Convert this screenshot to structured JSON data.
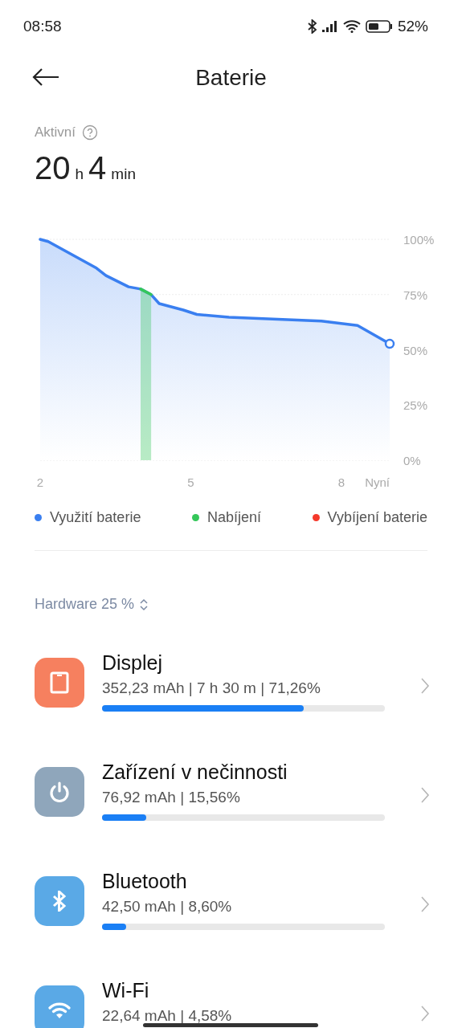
{
  "status_bar": {
    "time": "08:58",
    "battery": "52%"
  },
  "header": {
    "title": "Baterie"
  },
  "active": {
    "label": "Aktivní",
    "hours": "20",
    "hours_unit": "h",
    "minutes": "4",
    "minutes_unit": "min"
  },
  "chart": {
    "chart_data": {
      "type": "area",
      "x": [
        2,
        2.16,
        2.72,
        3.12,
        3.31,
        3.76,
        4.0,
        4.21,
        4.37,
        4.85,
        5.12,
        5.76,
        7.6,
        8.32,
        8.96
      ],
      "series": [
        {
          "name": "Využití baterie",
          "color": "#3a7ff0",
          "values": [
            100,
            99,
            92,
            87,
            83.6,
            78.5,
            77.5,
            75,
            70.9,
            68,
            66,
            64.7,
            63,
            61,
            52.7
          ]
        },
        {
          "name": "Nabíjení",
          "color": "#34c759",
          "values": [
            null,
            null,
            null,
            null,
            null,
            null,
            77.5,
            75,
            null,
            null,
            null,
            null,
            null,
            null,
            null
          ]
        }
      ],
      "xlim": [
        2,
        8.96
      ],
      "ylim": [
        0,
        100
      ],
      "grid": true,
      "xticks": [
        2,
        5,
        8,
        {
          "value": 8.96,
          "label": "Nyní"
        }
      ],
      "yticks": [
        {
          "value": 100,
          "label": "100%"
        },
        {
          "value": 75,
          "label": "75%"
        },
        {
          "value": 50,
          "label": "50%"
        },
        {
          "value": 25,
          "label": "25%"
        },
        {
          "value": 0,
          "label": "0%"
        }
      ]
    },
    "legend": [
      {
        "label": "Vybíjení baterie",
        "color": "#f5392b"
      }
    ]
  },
  "section": {
    "label": "Hardware 25 %"
  },
  "items": [
    {
      "kind": "display",
      "color": "#f6805f",
      "name": "Displej",
      "detail": "352,23 mAh | 7 h 30 m  | 71,26%",
      "level": 0.7126
    },
    {
      "kind": "idle",
      "color": "#8fa6bb",
      "name": "Zařízení v nečinnosti",
      "detail": "76,92 mAh | 15,56%",
      "level": 0.1556
    },
    {
      "kind": "bluetooth",
      "color": "#5aa9e6",
      "name": "Bluetooth",
      "detail": "42,50 mAh | 8,60%",
      "level": 0.086
    },
    {
      "kind": "wifi",
      "color": "#5aa9e6",
      "name": "Wi-Fi",
      "detail": "22,64 mAh | 4,58%"
    }
  ]
}
